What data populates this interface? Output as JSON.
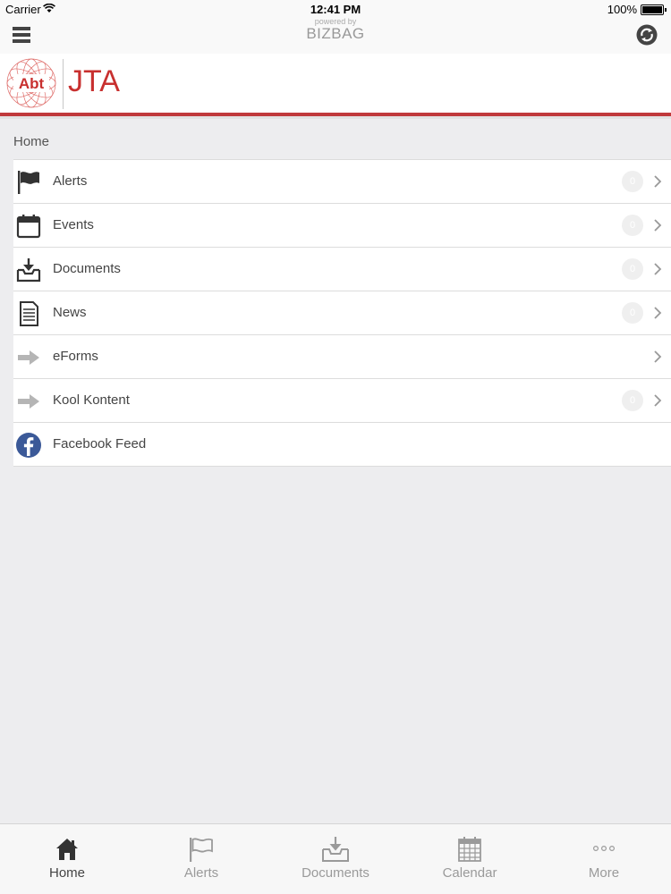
{
  "status_bar": {
    "carrier": "Carrier",
    "time": "12:41 PM",
    "battery": "100%"
  },
  "nav": {
    "powered_by": "powered by",
    "brand": "BIZBAG",
    "menu_icon": "hamburger-icon",
    "sync_icon": "sync-icon"
  },
  "logo": {
    "seal_text": "Abt",
    "wordmark": "JTA",
    "accent_color": "#c8302f"
  },
  "breadcrumb": "Home",
  "menu": {
    "items": [
      {
        "label": "Alerts",
        "icon": "flag-icon",
        "count": "0"
      },
      {
        "label": "Events",
        "icon": "calendar-icon",
        "count": "0"
      },
      {
        "label": "Documents",
        "icon": "inbox-download-icon",
        "count": "0"
      },
      {
        "label": "News",
        "icon": "document-icon",
        "count": "0"
      },
      {
        "label": "eForms",
        "icon": "arrow-right-icon"
      },
      {
        "label": "Kool Kontent",
        "icon": "arrow-right-icon",
        "count": "0"
      },
      {
        "label": "Facebook Feed",
        "icon": "facebook-icon"
      }
    ]
  },
  "tabs": [
    {
      "label": "Home",
      "icon": "home-icon",
      "active": true
    },
    {
      "label": "Alerts",
      "icon": "flag-icon"
    },
    {
      "label": "Documents",
      "icon": "inbox-download-icon"
    },
    {
      "label": "Calendar",
      "icon": "calendar-grid-icon"
    },
    {
      "label": "More",
      "icon": "more-dots-icon"
    }
  ]
}
